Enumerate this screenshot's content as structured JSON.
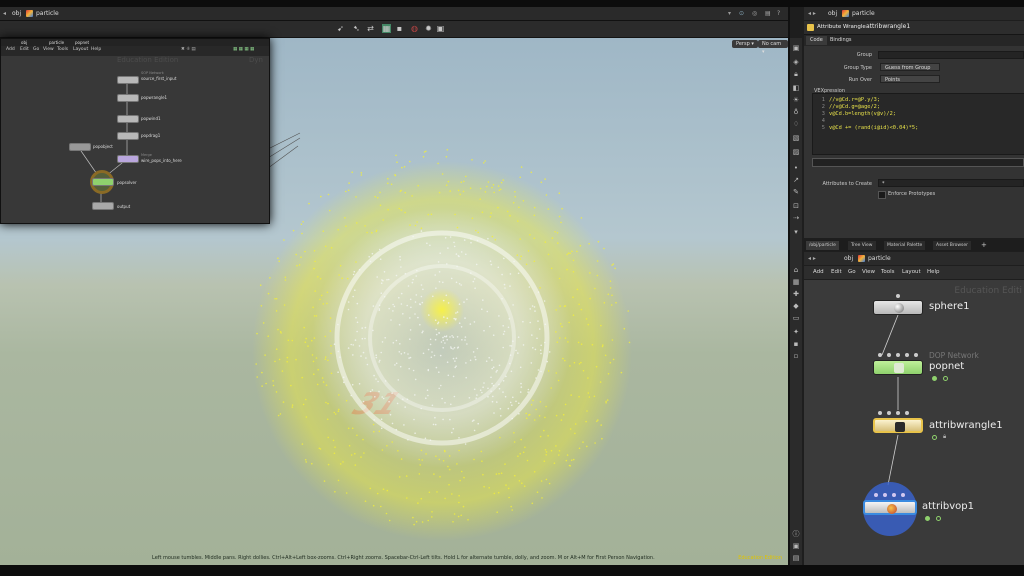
{
  "colors": {
    "particle_yellow": "#f2ef3a",
    "particle_white": "#f4f6f2",
    "sky": "#9fb7c6",
    "ground": "#aab7a0",
    "popnet_node": "#a8e07a",
    "wrangle_node": "#e8c34a",
    "vop_ring": "#3a62c9"
  },
  "viewport_path": {
    "level1": "obj",
    "level2": "particle"
  },
  "viewport": {
    "persp_label": "Persp ▾",
    "cam_label": "No cam ▾",
    "status_hint": "Left mouse tumbles. Middle pans. Right dollies. Ctrl+Alt+Left box-zooms. Ctrl+Right zooms. Spacebar-Ctrl-Left tilts. Hold L for alternate tumble, dolly, and zoom.    M or Alt+M for First Person Navigation.",
    "edition_watermark": "Education Edition",
    "ground_number": "31"
  },
  "mini_network": {
    "path": {
      "level1": "obj",
      "level2": "particle",
      "level3": "popnet"
    },
    "menu": [
      "Add",
      "Edit",
      "Go",
      "View",
      "Tools",
      "Layout",
      "Help"
    ],
    "watermark_left": "Education Edition",
    "watermark_right": "Dyn",
    "nodes": {
      "source_first_input": {
        "label": "source_first_input",
        "note": "SOP Network"
      },
      "popwrangle1": {
        "label": "popwrangle1"
      },
      "popwind1": {
        "label": "popwind1"
      },
      "popdrag1": {
        "label": "popdrag1"
      },
      "popobject": {
        "label": "popobject"
      },
      "wire_pops_into_here": {
        "label": "wire_pops_into_here",
        "note": "Merge"
      },
      "popsolver": {
        "label": "popsolver"
      },
      "output": {
        "label": "output"
      }
    }
  },
  "param_pane": {
    "path": {
      "level1": "obj",
      "level2": "particle"
    },
    "node_type": "Attribute Wrangle",
    "node_name": "attribwrangle1",
    "tabs": [
      "Code",
      "Bindings"
    ],
    "group_label": "Group",
    "group_value": "",
    "group_type_label": "Group Type",
    "group_type_value": "Guess from Group",
    "run_over_label": "Run Over",
    "run_over_value": "Points",
    "vexpression_label": "VEXpression",
    "code_lines": [
      {
        "n": "1",
        "text": "//v@Cd.r=@P.y/3;"
      },
      {
        "n": "2",
        "text": "//v@Cd.g=@age/2;"
      },
      {
        "n": "3",
        "text": "v@Cd.b=length(v@v)/2;"
      },
      {
        "n": "4",
        "text": ""
      },
      {
        "n": "5",
        "text": "v@Cd += (rand(i@id)<0.04)*5;"
      }
    ],
    "attributes_to_create_label": "Attributes to Create",
    "attributes_to_create_value": "*",
    "enforce_prototypes_label": "Enforce Prototypes"
  },
  "network_editor": {
    "tabs": [
      "/obj/particle",
      "Tree View",
      "Material Palette",
      "Asset Browser"
    ],
    "path": {
      "level1": "obj",
      "level2": "particle"
    },
    "menu": [
      "Add",
      "Edit",
      "Go",
      "View",
      "Tools",
      "Layout",
      "Help"
    ],
    "watermark": "Education Editi",
    "nodes": {
      "sphere1": {
        "label": "sphere1"
      },
      "popnet": {
        "label": "popnet",
        "comment": "DOP Network"
      },
      "attribwrangle1": {
        "label": "attribwrangle1"
      },
      "attribvop1": {
        "label": "attribvop1"
      }
    }
  }
}
